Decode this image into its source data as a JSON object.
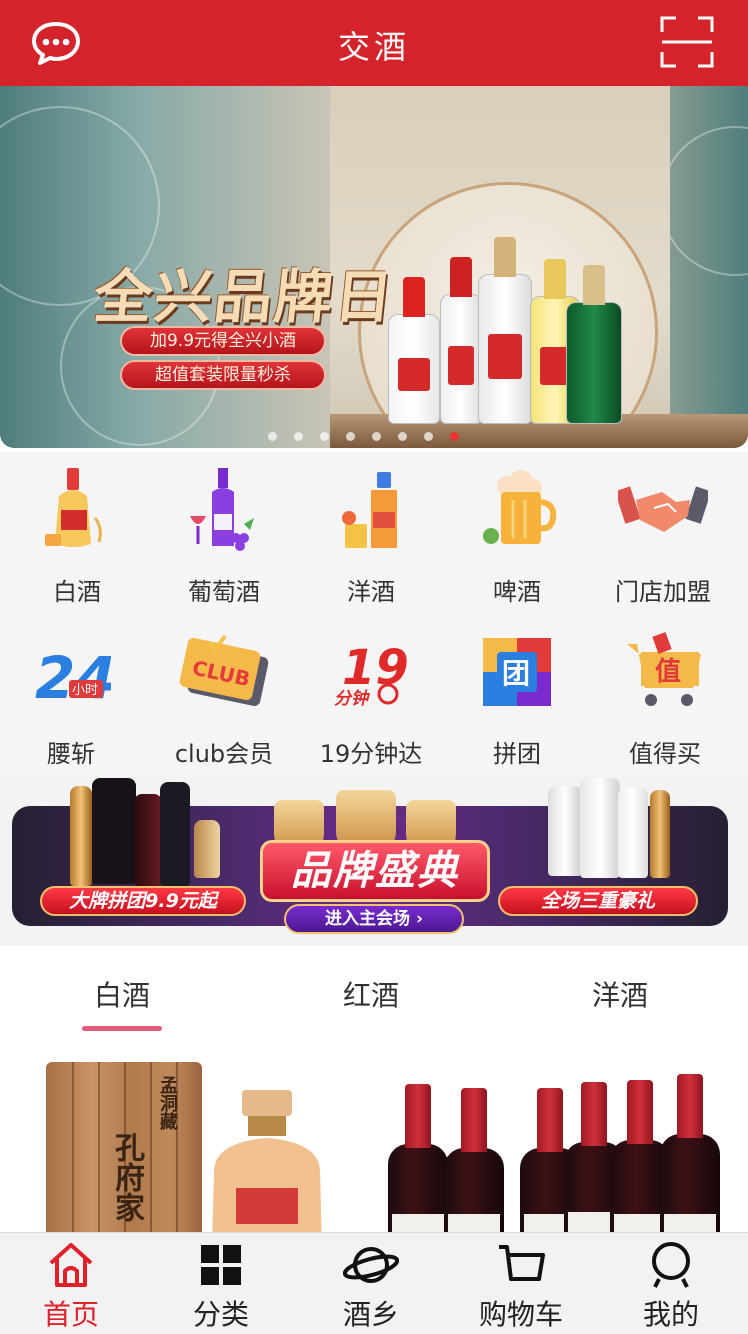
{
  "header": {
    "title": "交酒",
    "message_icon": "chat-bubble-icon",
    "scan_icon": "scan-icon",
    "bg_color": "#d5232c"
  },
  "hero_banner": {
    "headline": "全兴品牌日",
    "tag1": "加9.9元得全兴小酒",
    "tag2": "超值套装限量秒杀",
    "slide_count": 8,
    "active_slide": 8
  },
  "categories": [
    {
      "label": "白酒",
      "icon": "baijiu-bottle-icon"
    },
    {
      "label": "葡萄酒",
      "icon": "wine-grape-icon"
    },
    {
      "label": "洋酒",
      "icon": "whisky-bottle-icon"
    },
    {
      "label": "啤酒",
      "icon": "beer-mug-icon"
    },
    {
      "label": "门店加盟",
      "icon": "handshake-icon"
    },
    {
      "label": "腰斩",
      "icon": "24-hours-icon"
    },
    {
      "label": "club会员",
      "icon": "club-card-icon"
    },
    {
      "label": "19分钟达",
      "icon": "19-minutes-icon"
    },
    {
      "label": "拼团",
      "icon": "group-buy-icon"
    },
    {
      "label": "值得买",
      "icon": "cart-worth-icon"
    }
  ],
  "icon_text": {
    "hours_big": "24",
    "hours_small": "小时",
    "club": "CLUB",
    "minutes_big": "19",
    "minutes_small": "分钟",
    "group": "团",
    "worth": "值"
  },
  "promo_banner": {
    "title": "品牌盛典",
    "enter": "进入主会场 ›",
    "left_pill": "大牌拼团9.9元起",
    "right_pill": "全场三重豪礼"
  },
  "tabs": [
    {
      "label": "白酒",
      "active": true
    },
    {
      "label": "红酒",
      "active": false
    },
    {
      "label": "洋酒",
      "active": false
    }
  ],
  "products": {
    "box_text_1": "孔府家",
    "box_text_2": "孟洞藏"
  },
  "bottom_nav": [
    {
      "label": "首页",
      "icon": "home-icon",
      "active": true
    },
    {
      "label": "分类",
      "icon": "grid-icon",
      "active": false
    },
    {
      "label": "酒乡",
      "icon": "planet-icon",
      "active": false
    },
    {
      "label": "购物车",
      "icon": "cart-icon",
      "active": false
    },
    {
      "label": "我的",
      "icon": "user-icon",
      "active": false
    }
  ],
  "colors": {
    "brand_red": "#d5232c",
    "tab_underline": "#e25a7c",
    "nav_active": "#e0202a"
  }
}
